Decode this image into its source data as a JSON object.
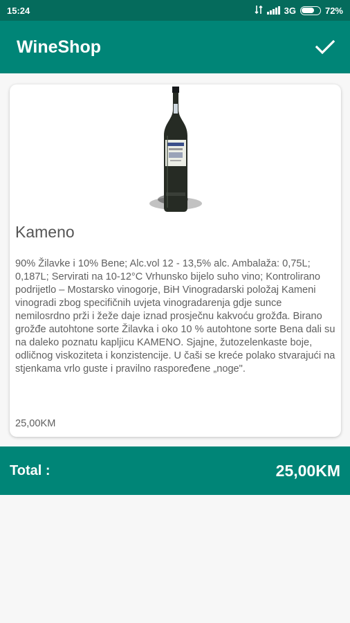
{
  "status_bar": {
    "time": "15:24",
    "network": "3G",
    "battery_percent": "72%",
    "battery_level": 0.72,
    "icons": [
      "data-arrows-icon",
      "signal-icon",
      "battery-icon"
    ]
  },
  "app_bar": {
    "title": "WineShop",
    "confirm_icon": "checkmark-icon"
  },
  "product": {
    "image_icon": "wine-bottle",
    "name": "Kameno",
    "description": "90% Žilavke i 10% Bene; Alc.vol 12 - 13,5% alc. Ambalaža: 0,75L; 0,187L; Servirati na 10-12°C Vrhunsko bijelo suho vino; Kontrolirano podrijetlo – Mostarsko vinogorje, BiH Vinogradarski položaj Kameni vinogradi zbog specifičnih uvjeta vinogradarenja gdje sunce nemilosrdno prži i žeže daje iznad prosječnu kakvoću grožđa. Birano grožđe autohtone sorte Žilavka i oko 10 % autohtone sorte Bena dali su na daleko poznatu kapljicu KAMENO. Sjajne, žutozelenkaste boje, odličnog viskoziteta i konzistencije. U čaši se kreće polako stvarajući na stjenkama vrlo guste i pravilno raspoređene „noge\".",
    "price": "25,00KM"
  },
  "total": {
    "label": "Total :",
    "value": "25,00KM"
  },
  "colors": {
    "primary": "#008577",
    "primary_dark": "#056b5c",
    "background": "#f7f7f7",
    "card": "#ffffff"
  }
}
